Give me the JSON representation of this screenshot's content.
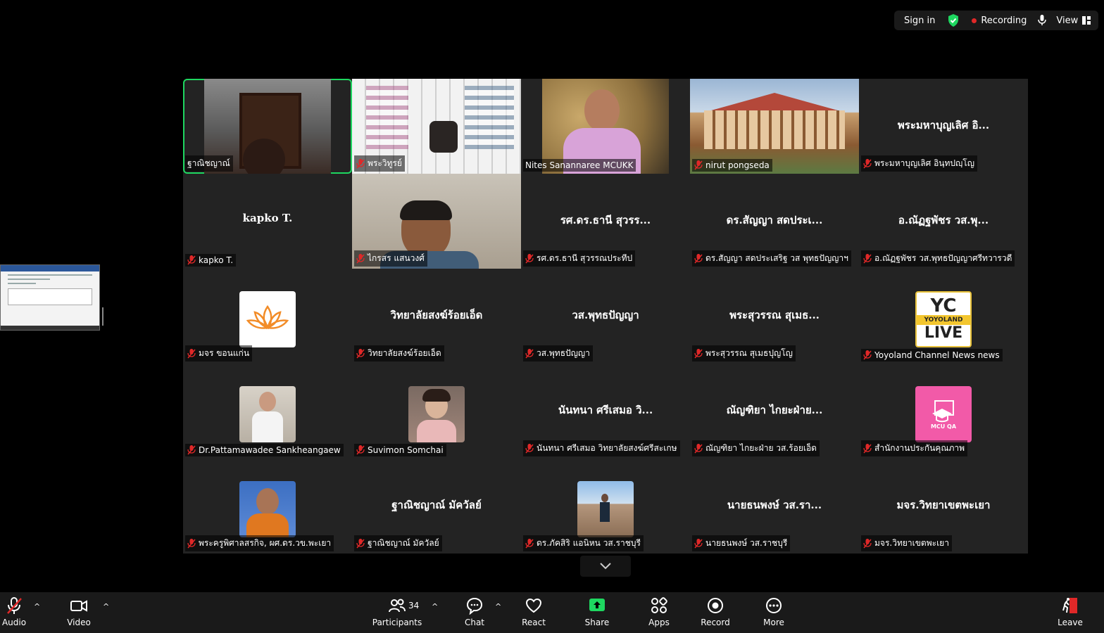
{
  "topbar": {
    "sign_in": "Sign in",
    "recording": "Recording",
    "view": "View",
    "rec_color": "#e02828",
    "shield_color": "#1ed760"
  },
  "gallery": {
    "tiles": [
      {
        "label": "ฐาณิชญาณ์",
        "display": "",
        "muted": false,
        "active": true
      },
      {
        "label": "พระวิทูรย์",
        "display": "",
        "muted": true
      },
      {
        "label": "Nites Sanannaree MCUKK",
        "display": "",
        "muted": false
      },
      {
        "label": "nirut pongseda",
        "display": "",
        "muted": true
      },
      {
        "label": "พระมหาบุญเลิศ อินฺทปญฺโญ",
        "display": "พระมหาบุญเลิศ อิ...",
        "muted": true
      },
      {
        "label": "kapko T.",
        "display": "kapko T.",
        "muted": true
      },
      {
        "label": "ไกรสร แสนวงศ์",
        "display": "",
        "muted": true
      },
      {
        "label": "รศ.ดร.ธานี สุวรรณประทีป",
        "display": "รศ.ดร.ธานี สุวรร...",
        "muted": true
      },
      {
        "label": "ดร.สัญญา สดประเสริฐ วส พุทธปัญญาฯ",
        "display": "ดร.สัญญา สดประเ...",
        "muted": true
      },
      {
        "label": "อ.ณัฏฐพัชร วส.พุทธปัญญาศรีทวารวดี",
        "display": "อ.ณัฏฐพัชร วส.พุ...",
        "muted": true
      },
      {
        "label": "มจร ขอนแก่น",
        "display": "",
        "muted": true
      },
      {
        "label": "วิทยาลัยสงฆ์ร้อยเอ็ด",
        "display": "วิทยาลัยสงฆ์ร้อยเอ็ด",
        "muted": true
      },
      {
        "label": "วส.พุทธปัญญา",
        "display": "วส.พุทธปัญญา",
        "muted": true
      },
      {
        "label": "พระสุวรรณ สุเมธปุญโญ",
        "display": "พระสุวรรณ สุเมธ...",
        "muted": true
      },
      {
        "label": "Yoyoland Channel News news",
        "display": "",
        "muted": true
      },
      {
        "label": "Dr.Pattamawadee Sankheangaew",
        "display": "",
        "muted": true
      },
      {
        "label": "Suvimon Somchai",
        "display": "",
        "muted": true
      },
      {
        "label": "นันทนา ศรีเสมอ วิทยาลัยสงฆ์ศรีสะเกษ",
        "display": "นันทนา ศรีเสมอ วิ...",
        "muted": true
      },
      {
        "label": "ณัญฑิยา ไกยะฝ่าย วส.ร้อยเอ็ด",
        "display": "ณัญฑิยา ไกยะฝ่าย...",
        "muted": true
      },
      {
        "label": "สำนักงานประกันคุณภาพ",
        "display": "",
        "muted": true
      },
      {
        "label": "พระครูพิศาลสรกิจ, ผศ.ดร.วข.พะเยา",
        "display": "",
        "muted": true
      },
      {
        "label": "ฐาณิชญาณ์ มัควัลย์",
        "display": "ฐาณิชญาณ์ มัควัลย์",
        "muted": true
      },
      {
        "label": "ดร.ภัคสิริ แอนิหน วส.ราชบุรี",
        "display": "",
        "muted": true
      },
      {
        "label": "นายธนพงษ์ วส.ราชบุรี",
        "display": "นายธนพงษ์ วส.รา...",
        "muted": true
      },
      {
        "label": "มจร.วิทยาเขตพะเยา",
        "display": "มจร.วิทยาเขตพะเยา",
        "muted": true
      }
    ],
    "logos": {
      "yc_top": "YC",
      "yc_mid": "YOYOLAND",
      "yc_bottom": "LIVE",
      "mcuqa": "MCU QA"
    }
  },
  "toolbar": {
    "audio": "Audio",
    "video": "Video",
    "participants": "Participants",
    "participant_count": "34",
    "chat": "Chat",
    "react": "React",
    "share": "Share",
    "apps": "Apps",
    "record": "Record",
    "more": "More",
    "leave": "Leave",
    "share_color": "#1ed760",
    "leave_color": "#e02828"
  }
}
